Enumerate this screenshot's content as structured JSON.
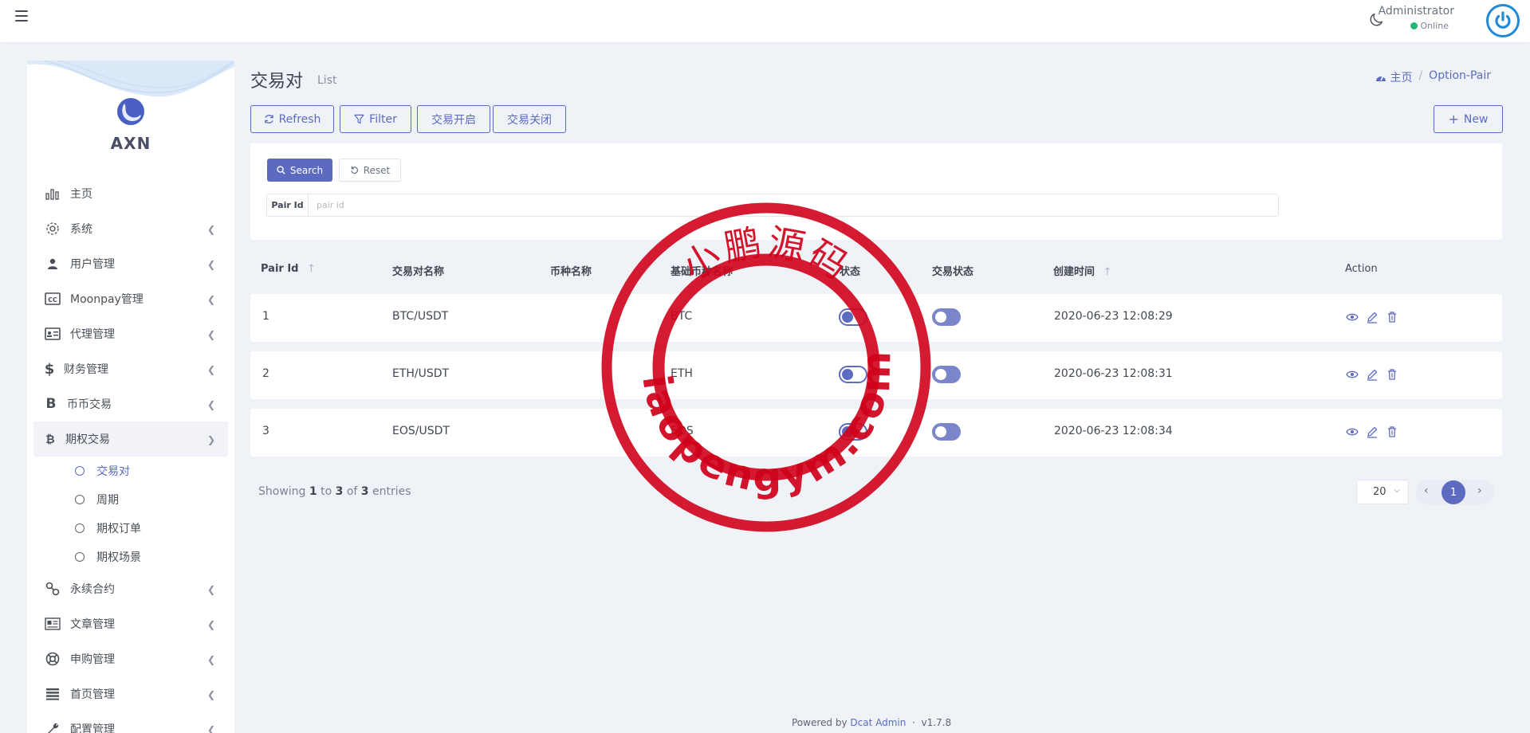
{
  "topbar": {
    "user_name": "Administrator",
    "user_status": "Online"
  },
  "brand": {
    "name": "AXN"
  },
  "sidebar": {
    "items": [
      {
        "label": "主页",
        "icon": "bar-chart-icon",
        "has_children": false
      },
      {
        "label": "系统",
        "icon": "gear-icon",
        "has_children": true
      },
      {
        "label": "用户管理",
        "icon": "user-icon",
        "has_children": true
      },
      {
        "label": "Moonpay管理",
        "icon": "cc-icon",
        "has_children": true
      },
      {
        "label": "代理管理",
        "icon": "id-card-icon",
        "has_children": true
      },
      {
        "label": "财务管理",
        "icon": "dollar-icon",
        "has_children": true
      },
      {
        "label": "币币交易",
        "icon": "bitcoin-b-icon",
        "has_children": true
      },
      {
        "label": "期权交易",
        "icon": "bitcoin-icon",
        "has_children": true,
        "expanded": true
      }
    ],
    "sub_items": [
      "交易对",
      "周期",
      "期权订单",
      "期权场景"
    ],
    "items_after": [
      {
        "label": "永续合约",
        "icon": "link-icon",
        "has_children": true
      },
      {
        "label": "文章管理",
        "icon": "newspaper-icon",
        "has_children": true
      },
      {
        "label": "申购管理",
        "icon": "lifering-icon",
        "has_children": true
      },
      {
        "label": "首页管理",
        "icon": "list-icon",
        "has_children": true
      },
      {
        "label": "配置管理",
        "icon": "wrench-icon",
        "has_children": true
      }
    ]
  },
  "header": {
    "title": "交易对",
    "subtitle": "List",
    "breadcrumb": [
      "主页",
      "Option-Pair"
    ]
  },
  "toolbar": {
    "refresh": "Refresh",
    "filter": "Filter",
    "open_trade": "交易开启",
    "close_trade": "交易关闭",
    "new": "New"
  },
  "filter": {
    "search": "Search",
    "reset": "Reset",
    "field_label": "Pair Id",
    "field_placeholder": "pair id",
    "field_value": ""
  },
  "table": {
    "columns": [
      "Pair Id",
      "交易对名称",
      "币种名称",
      "基础币种名称",
      "状态",
      "交易状态",
      "创建时间",
      "Action"
    ],
    "rows": [
      {
        "id": "1",
        "pair": "BTC/USDT",
        "coin": "",
        "base": "BTC",
        "status": false,
        "trade_status": false,
        "created": "2020-06-23 12:08:29"
      },
      {
        "id": "2",
        "pair": "ETH/USDT",
        "coin": "",
        "base": "ETH",
        "status": false,
        "trade_status": false,
        "created": "2020-06-23 12:08:31"
      },
      {
        "id": "3",
        "pair": "EOS/USDT",
        "coin": "",
        "base": "EOS",
        "status": false,
        "trade_status": false,
        "created": "2020-06-23 12:08:34"
      }
    ]
  },
  "pagination": {
    "showing_prefix": "Showing",
    "from": "1",
    "to_word": "to",
    "to": "3",
    "of_word": "of",
    "total": "3",
    "entries_word": "entries",
    "per_page": "20",
    "current_page": "1"
  },
  "footer": {
    "powered_by": "Powered by",
    "link": "Dcat Admin",
    "version": "v1.7.8"
  },
  "watermark": {
    "top_text": "小鹏源码",
    "bottom_text": "xiaopengym.com"
  },
  "colors": {
    "accent": "#5c6bc0",
    "background": "#eff3f8",
    "online": "#21b978",
    "stamp": "#d0021b"
  }
}
